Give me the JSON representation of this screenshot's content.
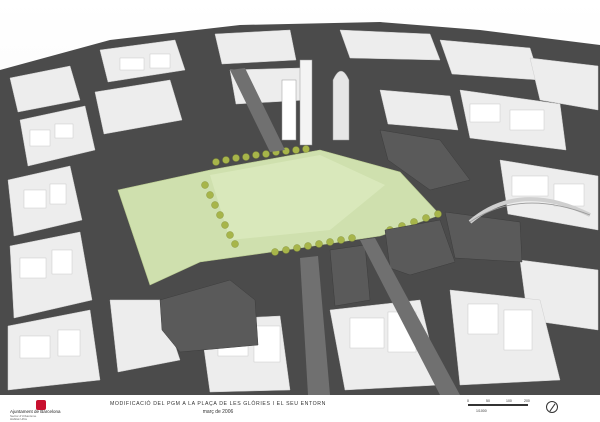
{
  "footer": {
    "logo_name": "Ajuntament de Barcelona",
    "logo_sub1": "Sector d'Urbanisme",
    "logo_sub2": "Hàbitat Urbà",
    "title": "MODIFICACIÓ DEL PGM A LA PLAÇA DE LES GLÒRIES I EL SEU ENTORN",
    "date": "març de 2006",
    "scale_ticks": [
      "0",
      "50",
      "100",
      "200"
    ],
    "scale_unit": "1/1000"
  },
  "colors": {
    "street": "#4b4b4b",
    "park": "#cfe0ae",
    "tree": "#a7b54a",
    "building": "#f0f0f0",
    "dark_building": "#5a5a5a",
    "accent": "#c8102e"
  }
}
